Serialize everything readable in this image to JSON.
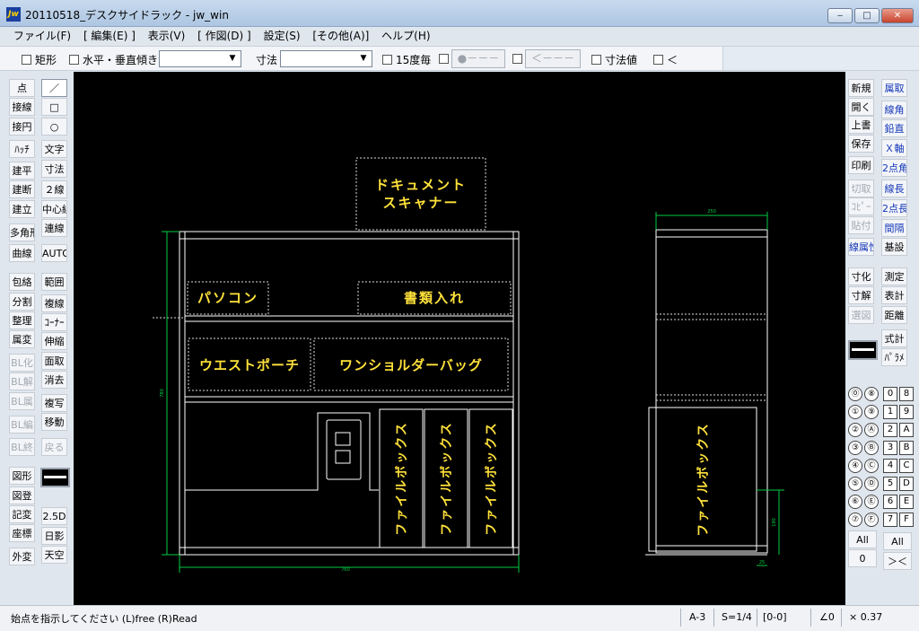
{
  "window": {
    "title": "20110518_デスクサイドラック - jw_win",
    "app_icon_text": "Jw",
    "minimize": "‒",
    "maximize": "□",
    "close": "✕"
  },
  "menu": [
    "ファイル(F)",
    "[ 編集(E) ]",
    "表示(V)",
    "[ 作図(D) ]",
    "設定(S)",
    "[その他(A)]",
    "ヘルプ(H)"
  ],
  "toolbar": {
    "rect_label": "矩形",
    "horiz_vert_label": "水平・垂直",
    "tilt_label": "傾き",
    "tilt_value": "",
    "dim_label": "寸法",
    "dim_value": "",
    "deg15_label": "15度毎",
    "btn_dot": "●－－－",
    "btn_arrow": "＜－－－",
    "dim_value_label": "寸法値",
    "lt_label": "＜"
  },
  "left_tools": [
    {
      "label": "点",
      "col": 0,
      "row": 0,
      "style": "n"
    },
    {
      "label": "／",
      "col": 1,
      "row": 0,
      "style": "sel"
    },
    {
      "label": "接線",
      "col": 0,
      "row": 1,
      "style": "n"
    },
    {
      "label": "□",
      "col": 1,
      "row": 1,
      "style": "n"
    },
    {
      "label": "接円",
      "col": 0,
      "row": 2,
      "style": "n"
    },
    {
      "label": "○",
      "col": 1,
      "row": 2,
      "style": "n"
    },
    {
      "label": "ﾊｯﾁ",
      "col": 0,
      "row": 3.2,
      "style": "n"
    },
    {
      "label": "文字",
      "col": 1,
      "row": 3.2,
      "style": "n"
    },
    {
      "label": "建平",
      "col": 0,
      "row": 4.3,
      "style": "n"
    },
    {
      "label": "寸法",
      "col": 1,
      "row": 4.2,
      "style": "n"
    },
    {
      "label": "建断",
      "col": 0,
      "row": 5.3,
      "style": "n"
    },
    {
      "label": "２線",
      "col": 1,
      "row": 5.3,
      "style": "n"
    },
    {
      "label": "建立",
      "col": 0,
      "row": 6.3,
      "style": "n"
    },
    {
      "label": "中心線",
      "col": 1,
      "row": 6.3,
      "style": "n"
    },
    {
      "label": "多角形",
      "col": 0,
      "row": 7.5,
      "style": "n"
    },
    {
      "label": "連線",
      "col": 1,
      "row": 7.3,
      "style": "n"
    },
    {
      "label": "曲線",
      "col": 0,
      "row": 8.6,
      "style": "n"
    },
    {
      "label": "AUTO",
      "col": 1,
      "row": 8.6,
      "style": "n"
    },
    {
      "label": "包絡",
      "col": 0,
      "row": 10.1,
      "style": "n"
    },
    {
      "label": "範囲",
      "col": 1,
      "row": 10.1,
      "style": "n"
    },
    {
      "label": "分割",
      "col": 0,
      "row": 11.1,
      "style": "n"
    },
    {
      "label": "複線",
      "col": 1,
      "row": 11.2,
      "style": "n"
    },
    {
      "label": "整理",
      "col": 0,
      "row": 12.1,
      "style": "n"
    },
    {
      "label": "ｺｰﾅｰ",
      "col": 1,
      "row": 12.2,
      "style": "n"
    },
    {
      "label": "属変",
      "col": 0,
      "row": 13.1,
      "style": "n"
    },
    {
      "label": "伸縮",
      "col": 1,
      "row": 13.2,
      "style": "n"
    },
    {
      "label": "BL化",
      "col": 0,
      "row": 14.3,
      "style": "dis"
    },
    {
      "label": "面取",
      "col": 1,
      "row": 14.2,
      "style": "n"
    },
    {
      "label": "BL解",
      "col": 0,
      "row": 15.3,
      "style": "dis"
    },
    {
      "label": "消去",
      "col": 1,
      "row": 15.2,
      "style": "n"
    },
    {
      "label": "BL属",
      "col": 0,
      "row": 16.3,
      "style": "dis"
    },
    {
      "label": "複写",
      "col": 1,
      "row": 16.4,
      "style": "n"
    },
    {
      "label": "BL編",
      "col": 0,
      "row": 17.5,
      "style": "dis"
    },
    {
      "label": "移動",
      "col": 1,
      "row": 17.4,
      "style": "n"
    },
    {
      "label": "BL終",
      "col": 0,
      "row": 18.7,
      "style": "dis"
    },
    {
      "label": "戻る",
      "col": 1,
      "row": 18.7,
      "style": "dis"
    },
    {
      "label": "図形",
      "col": 0,
      "row": 20.2,
      "style": "n"
    },
    {
      "label": "図登",
      "col": 0,
      "row": 21.2,
      "style": "n"
    },
    {
      "label": "記変",
      "col": 0,
      "row": 22.2,
      "style": "n"
    },
    {
      "label": "2.5D",
      "col": 1,
      "row": 22.3,
      "style": "n"
    },
    {
      "label": "座標",
      "col": 0,
      "row": 23.2,
      "style": "n"
    },
    {
      "label": "日影",
      "col": 1,
      "row": 23.3,
      "style": "n"
    },
    {
      "label": "外変",
      "col": 0,
      "row": 24.4,
      "style": "n"
    },
    {
      "label": "天空",
      "col": 1,
      "row": 24.3,
      "style": "n"
    }
  ],
  "right_tools": [
    {
      "label": "新規",
      "col": 0,
      "row": 0,
      "style": "n"
    },
    {
      "label": "属取",
      "col": 1,
      "row": 0,
      "style": "blue"
    },
    {
      "label": "開く",
      "col": 0,
      "row": 0.95,
      "style": "n"
    },
    {
      "label": "線角",
      "col": 1,
      "row": 1.1,
      "style": "blue"
    },
    {
      "label": "上書",
      "col": 0,
      "row": 1.9,
      "style": "n"
    },
    {
      "label": "鉛直",
      "col": 1,
      "row": 2.1,
      "style": "blue"
    },
    {
      "label": "保存",
      "col": 0,
      "row": 2.85,
      "style": "n"
    },
    {
      "label": "Ｘ軸",
      "col": 1,
      "row": 3.1,
      "style": "blue"
    },
    {
      "label": "印刷",
      "col": 0,
      "row": 4.0,
      "style": "n"
    },
    {
      "label": "2点角",
      "col": 1,
      "row": 4.1,
      "style": "blue"
    },
    {
      "label": "切取",
      "col": 0,
      "row": 5.2,
      "style": "dis"
    },
    {
      "label": "線長",
      "col": 1,
      "row": 5.2,
      "style": "blue"
    },
    {
      "label": "ｺﾋﾟｰ",
      "col": 0,
      "row": 6.1,
      "style": "dis"
    },
    {
      "label": "2点長",
      "col": 1,
      "row": 6.2,
      "style": "blue"
    },
    {
      "label": "貼付",
      "col": 0,
      "row": 7.1,
      "style": "dis"
    },
    {
      "label": "間隔",
      "col": 1,
      "row": 7.2,
      "style": "blue"
    },
    {
      "label": "線属性",
      "col": 0,
      "row": 8.2,
      "style": "blue"
    },
    {
      "label": "基設",
      "col": 1,
      "row": 8.2,
      "style": "n"
    },
    {
      "label": "寸化",
      "col": 0,
      "row": 9.7,
      "style": "n"
    },
    {
      "label": "測定",
      "col": 1,
      "row": 9.7,
      "style": "n"
    },
    {
      "label": "寸解",
      "col": 0,
      "row": 10.7,
      "style": "n"
    },
    {
      "label": "表計",
      "col": 1,
      "row": 10.7,
      "style": "n"
    },
    {
      "label": "選図",
      "col": 0,
      "row": 11.7,
      "style": "dis"
    },
    {
      "label": "距離",
      "col": 1,
      "row": 11.7,
      "style": "n"
    },
    {
      "label": "式計",
      "col": 1,
      "row": 12.9,
      "style": "n"
    },
    {
      "label": "ﾊﾟﾗﾒ",
      "col": 1,
      "row": 13.9,
      "style": "n"
    }
  ],
  "layer_groups": [
    "⓪",
    "①",
    "②",
    "③",
    "④",
    "⑤",
    "⑥",
    "⑦"
  ],
  "layer_groups_b": [
    "⑧",
    "⑨",
    "Ⓐ",
    "Ⓑ",
    "Ⓒ",
    "Ⓓ",
    "Ⓔ",
    "Ⓕ"
  ],
  "layers": [
    "0",
    "1",
    "2",
    "3",
    "4",
    "5",
    "6",
    "7"
  ],
  "layers_b": [
    "8",
    "9",
    "A",
    "B",
    "C",
    "D",
    "E",
    "F"
  ],
  "layer_buttons": {
    "all_a": "All",
    "zero": "0",
    "all_b": "All",
    "x": "＞＜"
  },
  "drawing": {
    "labels": {
      "scanner_1": "ドキュメント",
      "scanner_2": "スキャナー",
      "pc": "パソコン",
      "docs": "書類入れ",
      "waist": "ウエストポーチ",
      "bag": "ワンショルダーバッグ",
      "file1": "ファイルボックス",
      "file2": "ファイルボックス",
      "file3": "ファイルボックス",
      "file_side": "ファイルボックス"
    },
    "dims": {
      "front_width": "760",
      "front_height": "780",
      "side_width": "250",
      "side_small_h": "190",
      "side_small_w": "25"
    },
    "colors": {
      "line": "#ffffff",
      "text": "#ffe23a",
      "dim": "#00cc44",
      "dotted": "#dddddd"
    }
  },
  "status": {
    "message": "始点を指示してください (L)free (R)Read",
    "paper": "A-3",
    "scale": "S=1/4",
    "layer": "[0-0]",
    "angle": "∠0",
    "zoom": "× 0.37"
  }
}
